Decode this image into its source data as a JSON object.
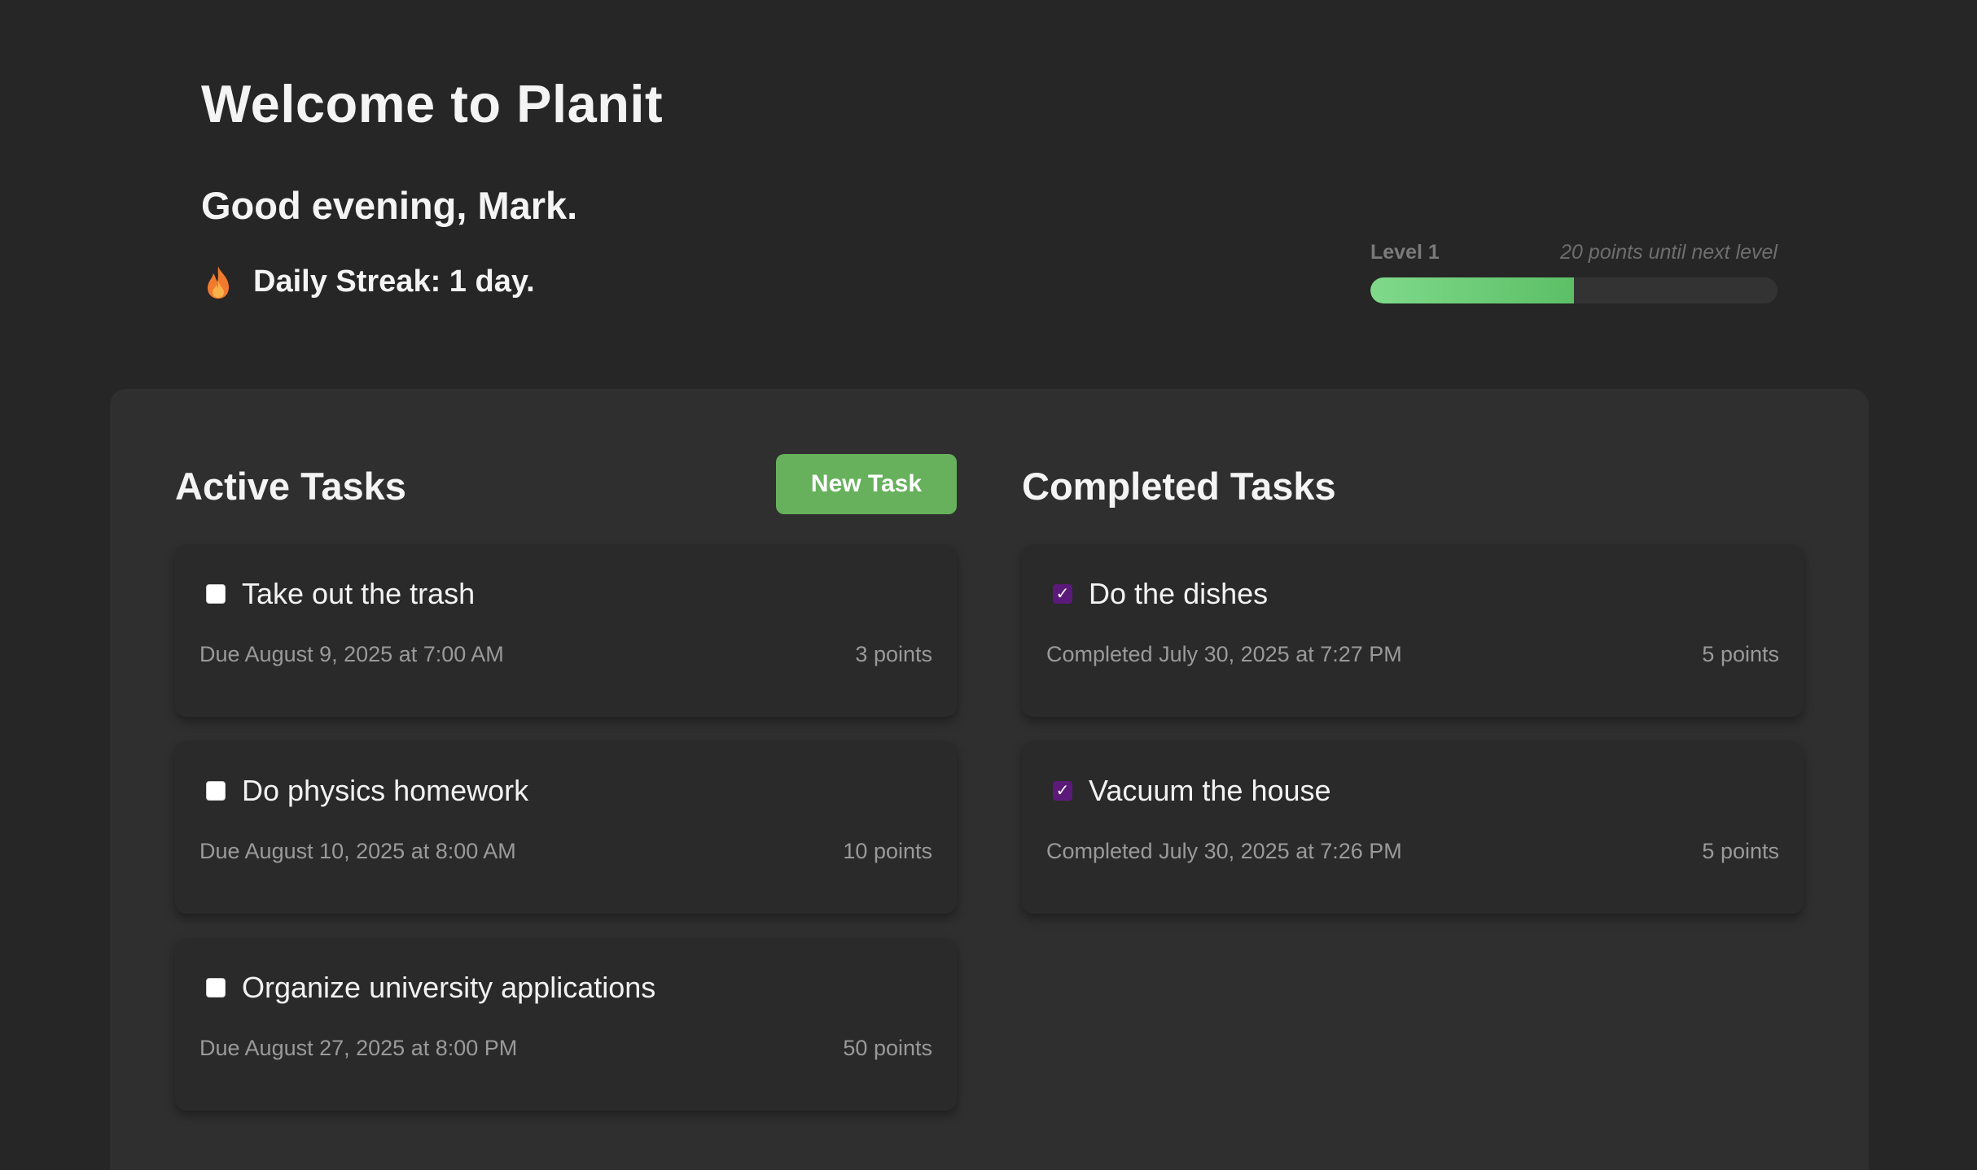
{
  "header": {
    "app_title": "Welcome to Planit",
    "greeting": "Good evening, Mark.",
    "streak_text": "Daily Streak: 1 day.",
    "streak_icon": "fire-icon"
  },
  "level": {
    "label": "Level 1",
    "remaining_text": "20 points until next level",
    "progress_fraction": 0.5,
    "colors": {
      "fill_start": "#7fda8a",
      "fill_end": "#5cbf66",
      "track": "#333333"
    }
  },
  "active": {
    "title": "Active Tasks",
    "new_task_label": "New Task",
    "tasks": [
      {
        "title": "Take out the trash",
        "due": "Due August 9, 2025 at 7:00 AM",
        "points": "3 points",
        "checked": false
      },
      {
        "title": "Do physics homework",
        "due": "Due August 10, 2025 at 8:00 AM",
        "points": "10 points",
        "checked": false
      },
      {
        "title": "Organize university applications",
        "due": "Due August 27, 2025 at 8:00 PM",
        "points": "50 points",
        "checked": false
      }
    ]
  },
  "completed": {
    "title": "Completed Tasks",
    "tasks": [
      {
        "title": "Do the dishes",
        "completed": "Completed July 30, 2025 at 7:27 PM",
        "points": "5 points",
        "checked": true
      },
      {
        "title": "Vacuum the house",
        "completed": "Completed July 30, 2025 at 7:26 PM",
        "points": "5 points",
        "checked": true
      }
    ]
  },
  "colors": {
    "background": "#262626",
    "panel": "#2f2f2f",
    "card": "#2a2a2a",
    "accent_green": "#67b15d",
    "checkbox_checked": "#5b1a7a"
  }
}
